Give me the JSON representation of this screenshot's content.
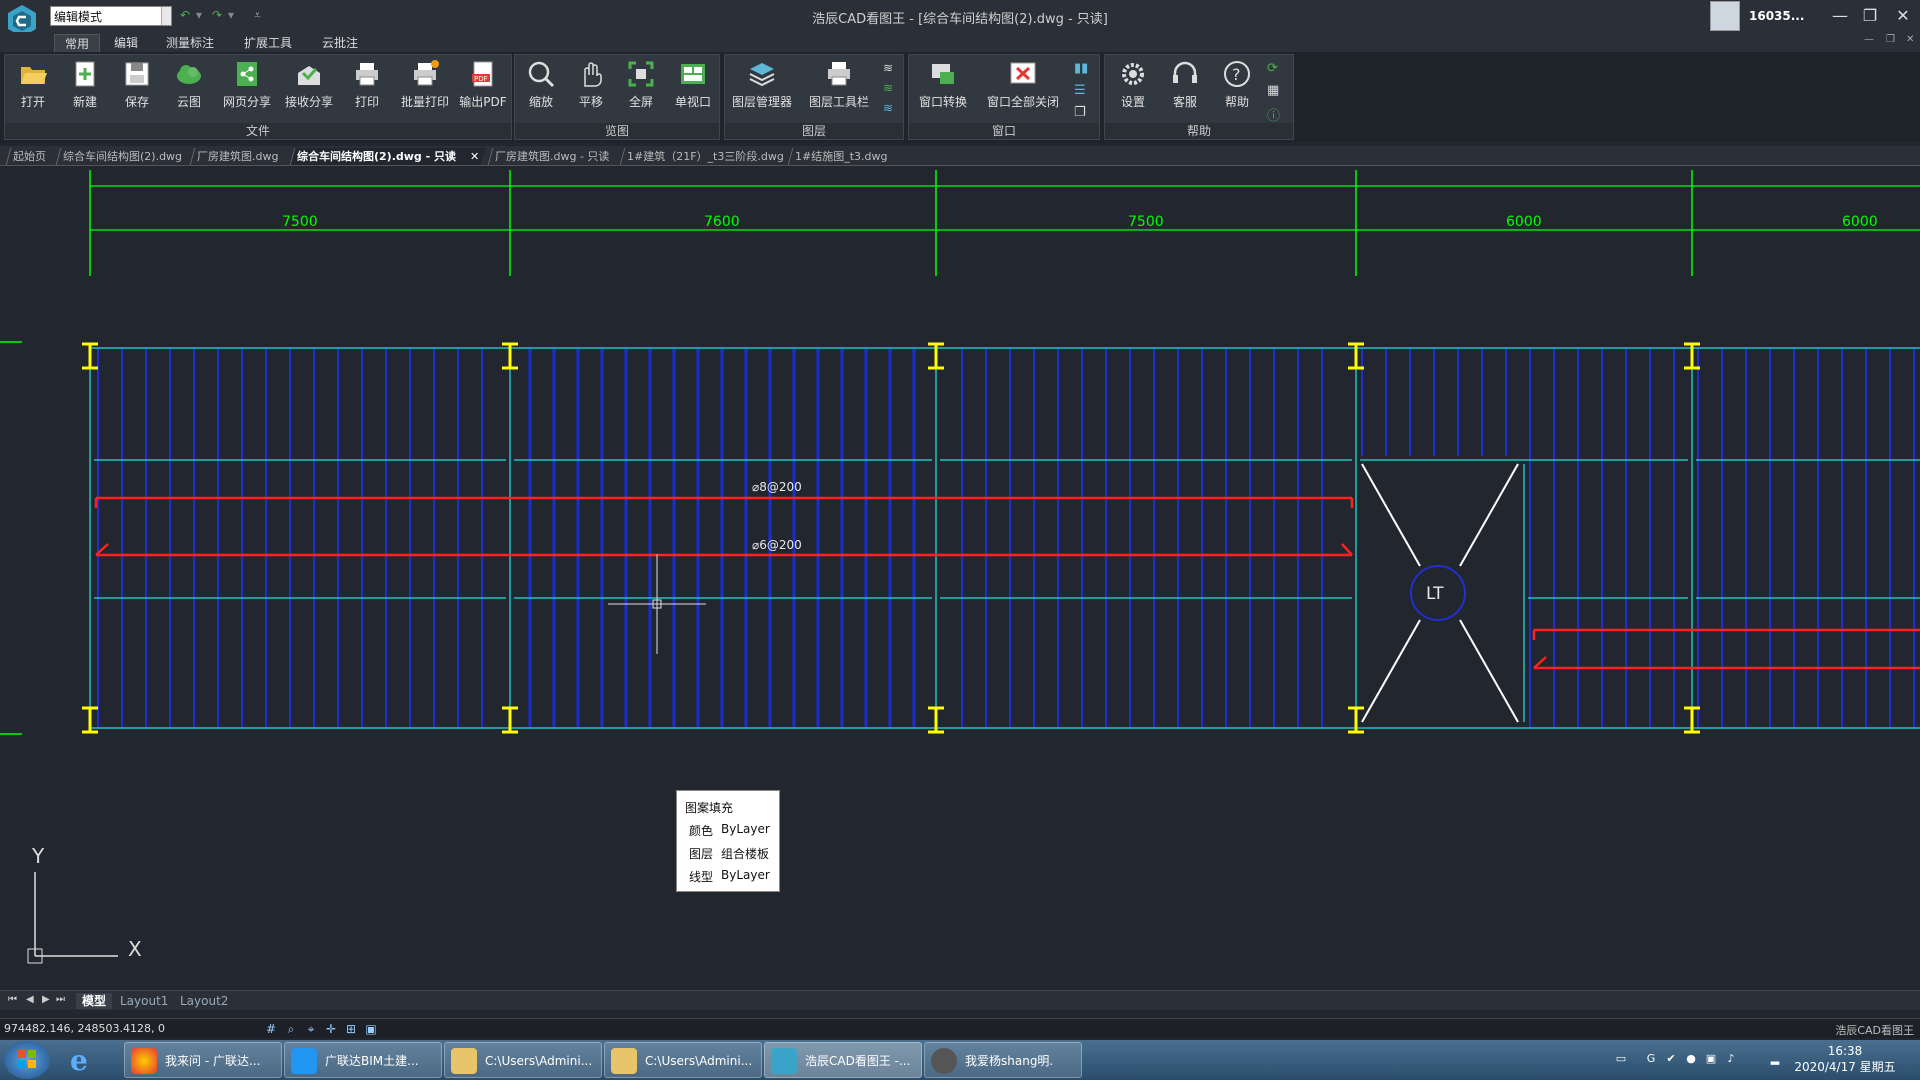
{
  "titlebar": {
    "mode": "编辑模式",
    "title": "浩辰CAD看图王 - [综合车间结构图(2).dwg - 只读]",
    "user": "16035...",
    "controls": {
      "minimize": "—",
      "maximize": "❐",
      "close": "✕"
    }
  },
  "menu": {
    "tabs": [
      "常用",
      "编辑",
      "测量标注",
      "扩展工具",
      "云批注"
    ],
    "active": "常用"
  },
  "ribbon": {
    "groups": [
      {
        "label": "文件",
        "buttons": [
          "打开",
          "新建",
          "保存",
          "云图",
          "网页分享",
          "接收分享",
          "打印",
          "批量打印",
          "输出PDF"
        ]
      },
      {
        "label": "览图",
        "buttons": [
          "缩放",
          "平移",
          "全屏",
          "单视口"
        ]
      },
      {
        "label": "图层",
        "buttons": [
          "图层管理器",
          "图层工具栏"
        ]
      },
      {
        "label": "窗口",
        "buttons": [
          "窗口转换",
          "窗口全部关闭"
        ]
      },
      {
        "label": "帮助",
        "buttons": [
          "设置",
          "客服",
          "帮助"
        ]
      }
    ]
  },
  "doc_tabs": [
    {
      "label": "起始页",
      "active": false
    },
    {
      "label": "综合车间结构图(2).dwg",
      "active": false
    },
    {
      "label": "厂房建筑图.dwg",
      "active": false
    },
    {
      "label": "综合车间结构图(2).dwg - 只读",
      "active": true
    },
    {
      "label": "厂房建筑图.dwg - 只读",
      "active": false
    },
    {
      "label": "1#建筑（21F）_t3三阶段.dwg",
      "active": false
    },
    {
      "label": "1#结施图_t3.dwg",
      "active": false
    }
  ],
  "drawing": {
    "dimensions": [
      "7500",
      "7600",
      "7500",
      "6000",
      "6000"
    ],
    "rebar_labels": [
      "⌀8@200",
      "⌀6@200"
    ],
    "stair_label": "LT",
    "axis_y": "Y",
    "axis_x": "X",
    "colors": {
      "dimension": "#00ff00",
      "axis": "#ffff00",
      "beam": "#20c0c0",
      "rebar": "#ff2020",
      "hatch": "#1a2fd0"
    }
  },
  "tooltip": {
    "title": "图案填充",
    "rows": [
      {
        "k": "颜色",
        "v": "ByLayer"
      },
      {
        "k": "图层",
        "v": "组合楼板"
      },
      {
        "k": "线型",
        "v": "ByLayer"
      }
    ]
  },
  "layout_tabs": [
    "模型",
    "Layout1",
    "Layout2"
  ],
  "status": {
    "coords": "974482.146, 248503.4128, 0",
    "brand": "浩辰CAD看图王"
  },
  "taskbar": {
    "items": [
      "我来问 - 广联达...",
      "广联达BIM土建...",
      "C:\\Users\\Admini...",
      "C:\\Users\\Admini...",
      "浩辰CAD看图王 -...",
      "我爱杨shang明."
    ],
    "time": "16:38",
    "date": "2020/4/17 星期五"
  }
}
